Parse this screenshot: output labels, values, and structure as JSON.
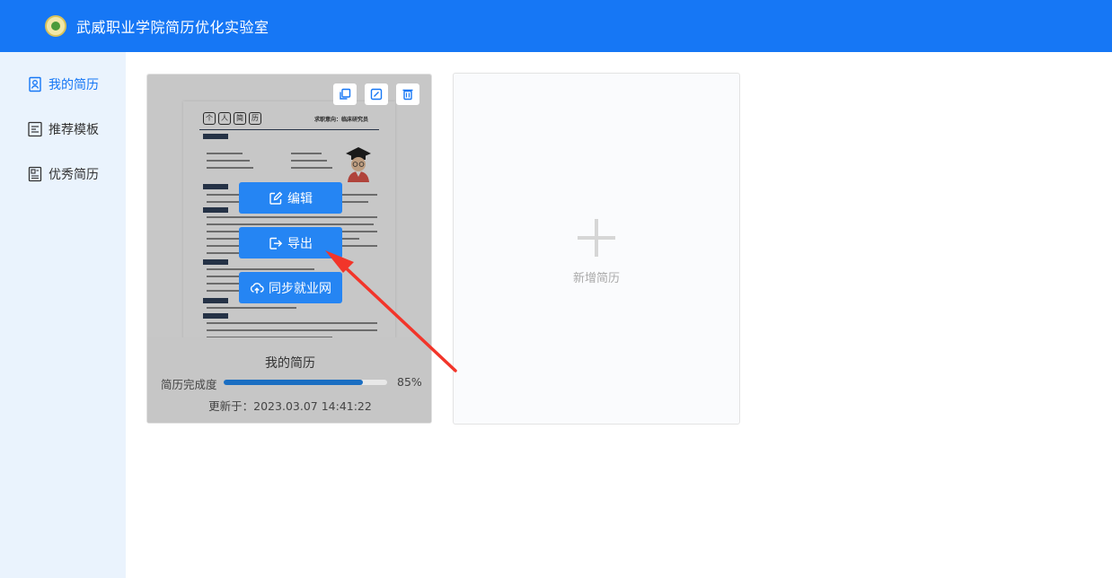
{
  "header": {
    "title": "武威职业学院简历优化实验室"
  },
  "sidebar": {
    "items": [
      {
        "label": "我的简历",
        "icon": "person-card-icon",
        "active": true
      },
      {
        "label": "推荐模板",
        "icon": "template-icon",
        "active": false
      },
      {
        "label": "优秀简历",
        "icon": "document-list-icon",
        "active": false
      }
    ]
  },
  "resume_card": {
    "preview": {
      "header_chars": [
        "个",
        "人",
        "简",
        "历"
      ],
      "objective": "求职意向：临床研究员"
    },
    "toolbar": [
      "copy-icon",
      "edit-icon",
      "delete-icon"
    ],
    "overlay": {
      "edit_label": "编辑",
      "export_label": "导出",
      "sync_label": "同步就业网"
    },
    "name": "我的简历",
    "progress_label": "简历完成度",
    "progress_value": 0.85,
    "progress_text": "85%",
    "updated_label": "更新于：",
    "updated_time": "2023.03.07 14:41:22"
  },
  "new_card": {
    "label": "新增简历"
  },
  "colors": {
    "primary": "#1677f5",
    "sidebar_bg": "#eaf3fd",
    "button": "#2585f3",
    "arrow": "#f2352a"
  }
}
